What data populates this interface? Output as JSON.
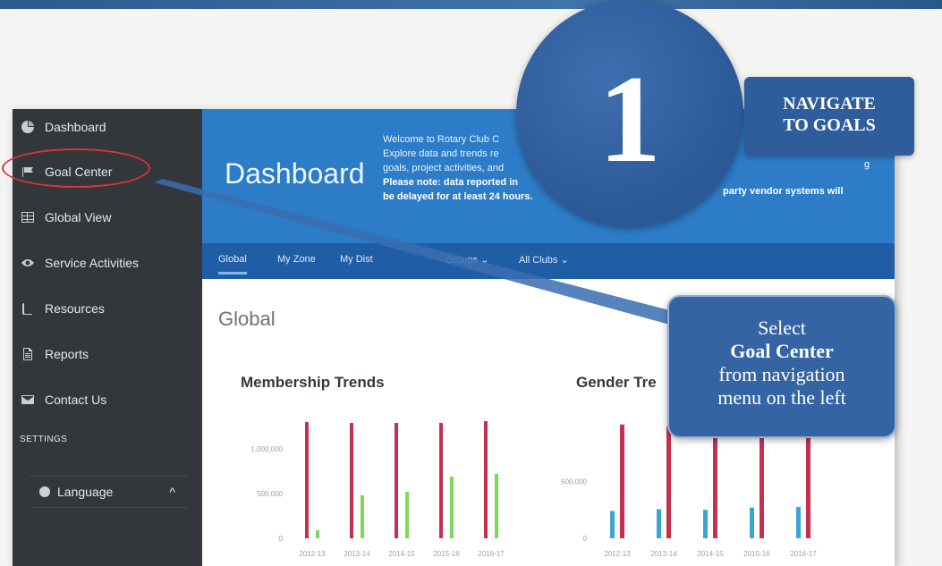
{
  "sidebar": {
    "items": [
      {
        "label": "Dashboard",
        "icon": "pie-chart-icon"
      },
      {
        "label": "Goal Center",
        "icon": "flag-icon"
      },
      {
        "label": "Global View",
        "icon": "grid-icon"
      },
      {
        "label": "Service Activities",
        "icon": "eye-icon"
      },
      {
        "label": "Resources",
        "icon": "book-icon"
      },
      {
        "label": "Reports",
        "icon": "document-icon"
      },
      {
        "label": "Contact Us",
        "icon": "envelope-icon"
      }
    ],
    "settings_label": "SETTINGS",
    "language_label": "Language",
    "language_caret": "^"
  },
  "banner": {
    "title": "Dashboard",
    "welcome_lines": [
      "Welcome to Rotary Club C",
      "Explore data and trends re",
      "goals, project activities, and"
    ],
    "note_line1": "Please note: data reported in",
    "note_line2": "be delayed for at least 24 hours.",
    "note_right": "party vendor systems will",
    "right_fragment": "g"
  },
  "tabs": [
    {
      "label": "Global"
    },
    {
      "label": "My Zone"
    },
    {
      "label": "My Dist"
    },
    {
      "label": "Groups ⌄"
    },
    {
      "label": "All Clubs ⌄"
    }
  ],
  "main": {
    "section_title": "Global",
    "card1_title": "Membership Trends",
    "card2_title": "Gender Tre"
  },
  "overlays": {
    "step_number": "1",
    "step_title_line1": "NAVIGATE",
    "step_title_line2": "TO GOALS",
    "callout_line1": "Select",
    "callout_line2": "Goal Center",
    "callout_line3": "from navigation",
    "callout_line4": "menu on the left"
  },
  "colors": {
    "sidebar": "#33363b",
    "banner": "#2d7cc7",
    "tabs": "#1f5ea6",
    "members_bar": "#c4314f",
    "secondary_bar": "#7fd85a",
    "gender_bar": "#3ba3d6",
    "overlay_blue": "#2f5d9c",
    "highlight_ring": "#d3373d"
  },
  "chart_data": [
    {
      "type": "bar",
      "title": "Membership Trends",
      "categories": [
        "2012-13",
        "2013-14",
        "2014-15",
        "2015-16",
        "2016-17"
      ],
      "y_ticks": [
        "1,000,000",
        "500,000",
        "0"
      ],
      "ylim": [
        0,
        1400000
      ],
      "series": [
        {
          "values": [
            1300000,
            1290000,
            1290000,
            1290000,
            1310000
          ],
          "color": "#c4314f"
        },
        {
          "values": [
            90000,
            480000,
            520000,
            690000,
            720000
          ],
          "color": "#7fd85a"
        }
      ]
    },
    {
      "type": "bar",
      "title": "Gender Tre",
      "categories": [
        "2012-13",
        "2013-14",
        "2014-15",
        "2015-16",
        "2016-17"
      ],
      "y_ticks": [
        "500,000",
        "0"
      ],
      "ylim": [
        0,
        1100000
      ],
      "series": [
        {
          "values": [
            240000,
            255000,
            250000,
            270000,
            275000
          ],
          "color": "#3ba3d6"
        },
        {
          "values": [
            1000000,
            980000,
            990000,
            990000,
            1000000
          ],
          "color": "#c4314f"
        }
      ]
    }
  ]
}
